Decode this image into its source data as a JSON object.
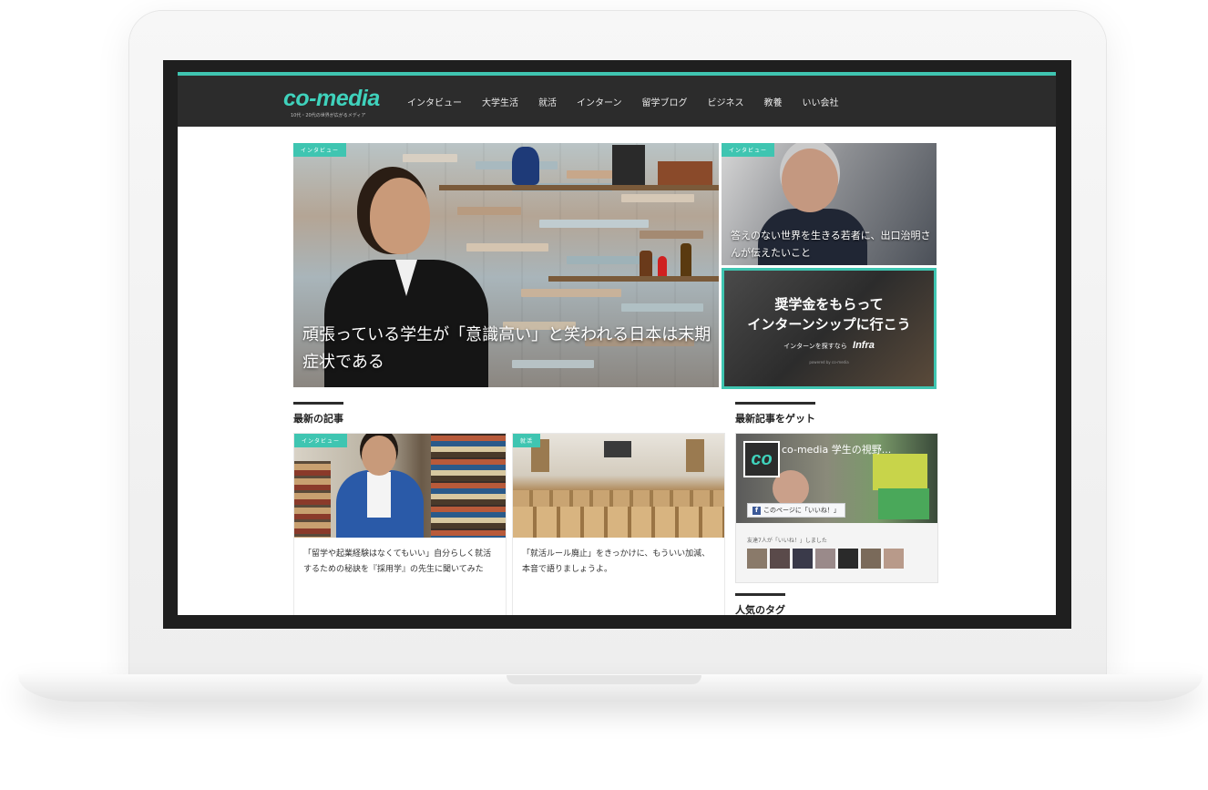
{
  "site": {
    "logo": "co-media",
    "tagline": "10代・20代の世界が広がるメディア",
    "nav": [
      "インタビュー",
      "大学生活",
      "就活",
      "インターン",
      "留学ブログ",
      "ビジネス",
      "教養",
      "いい会社"
    ],
    "accent_color": "#3fc5b1"
  },
  "hero": {
    "main": {
      "badge": "インタビュー",
      "title": "頑張っている学生が「意識高い」と笑われる日本は末期症状である"
    },
    "side": {
      "badge": "インタビュー",
      "title": "答えのない世界を生きる若者に、出口治明さんが伝えたいこと"
    },
    "banner": {
      "line1": "奨学金をもらって",
      "line2": "インターンシップに行こう",
      "sub": "インターンを探すなら",
      "brand": "Infra",
      "foot": "powered by co-media"
    }
  },
  "latest": {
    "heading": "最新の記事",
    "cards": [
      {
        "badge": "インタビュー",
        "title": "「留学や起業経験はなくてもいい」自分らしく就活するための秘訣を『採用学』の先生に聞いてみた"
      },
      {
        "badge": "就活",
        "title": "「就活ルール廃止」をきっかけに、もういい加減、本音で語りましょうよ。"
      }
    ]
  },
  "sidebar": {
    "get_heading": "最新記事をゲット",
    "fb": {
      "logo": "co",
      "page_name": "co-media 学生の視野...",
      "like_button": "このページに「いいね！」",
      "like_icon": "f",
      "friends_text": "友達7人が「いいね！」しました"
    },
    "tags_heading": "人気のタグ"
  }
}
